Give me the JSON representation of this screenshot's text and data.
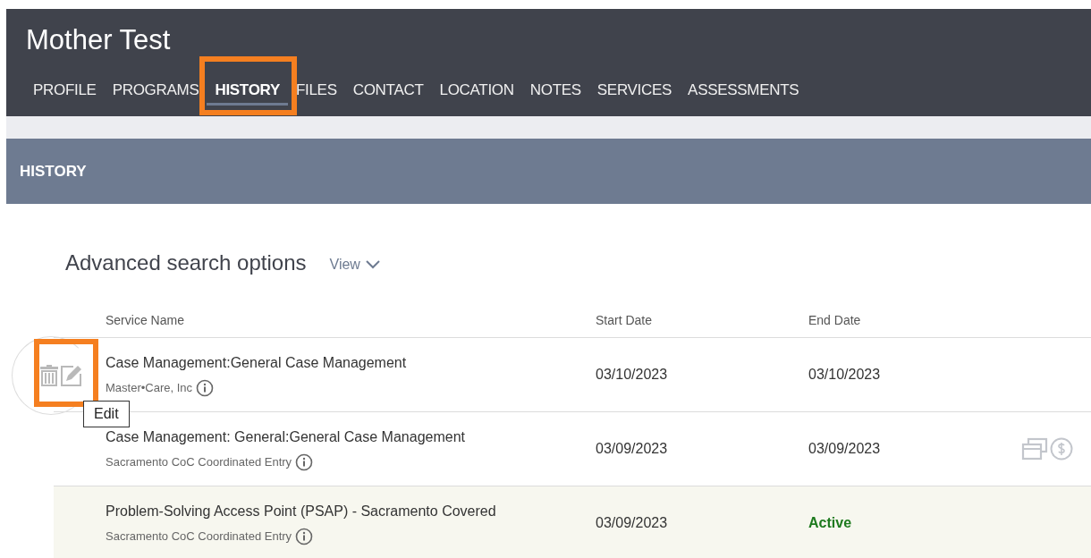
{
  "header": {
    "title": "Mother Test"
  },
  "tabs": [
    {
      "label": "PROFILE",
      "selected": false,
      "annotated": false
    },
    {
      "label": "PROGRAMS",
      "selected": false,
      "annotated": false
    },
    {
      "label": "HISTORY",
      "selected": true,
      "annotated": true
    },
    {
      "label": "FILES",
      "selected": false,
      "annotated": false
    },
    {
      "label": "CONTACT",
      "selected": false,
      "annotated": false
    },
    {
      "label": "LOCATION",
      "selected": false,
      "annotated": false
    },
    {
      "label": "NOTES",
      "selected": false,
      "annotated": false
    },
    {
      "label": "SERVICES",
      "selected": false,
      "annotated": false
    },
    {
      "label": "ASSESSMENTS",
      "selected": false,
      "annotated": false
    }
  ],
  "section": {
    "title": "HISTORY"
  },
  "search": {
    "title": "Advanced search options",
    "view_label": "View"
  },
  "table": {
    "columns": [
      "Service Name",
      "Start Date",
      "End Date"
    ],
    "rows": [
      {
        "service": "Case Management:General Case Management",
        "provider": "Master•Care, Inc",
        "start": "03/10/2023",
        "end": "03/10/2023",
        "end_active": false,
        "selected": false,
        "hover_actions": true,
        "annotated": true,
        "tooltip": "Edit",
        "side_icons": false
      },
      {
        "service": "Case Management: General:General Case Management",
        "provider": "Sacramento CoC Coordinated Entry",
        "start": "03/09/2023",
        "end": "03/09/2023",
        "end_active": false,
        "selected": false,
        "hover_actions": false,
        "annotated": false,
        "side_icons": true
      },
      {
        "service": "Problem-Solving Access Point (PSAP) - Sacramento Covered",
        "provider": "Sacramento CoC Coordinated Entry",
        "start": "03/09/2023",
        "end": "Active",
        "end_active": true,
        "selected": true,
        "hover_actions": false,
        "annotated": false,
        "side_icons": false
      }
    ]
  }
}
